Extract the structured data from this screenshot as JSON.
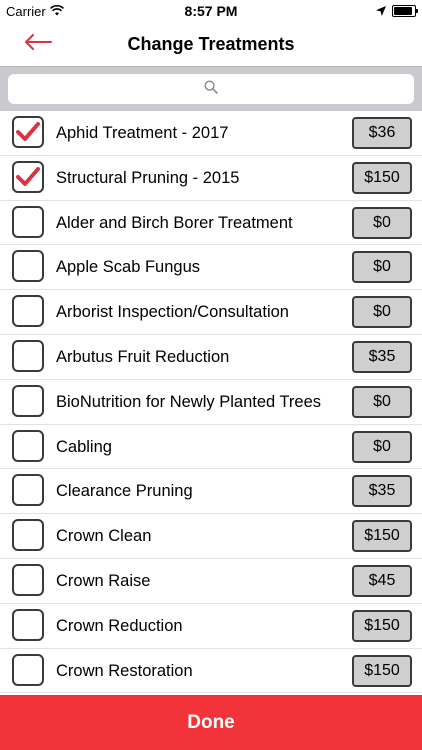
{
  "status_bar": {
    "carrier": "Carrier",
    "time": "8:57 PM"
  },
  "nav": {
    "title": "Change Treatments"
  },
  "search": {
    "placeholder": ""
  },
  "treatments": [
    {
      "label": "Aphid Treatment - 2017",
      "price": "$36",
      "checked": true
    },
    {
      "label": "Structural Pruning - 2015",
      "price": "$150",
      "checked": true
    },
    {
      "label": "Alder and Birch Borer Treatment",
      "price": "$0",
      "checked": false
    },
    {
      "label": "Apple Scab Fungus",
      "price": "$0",
      "checked": false
    },
    {
      "label": "Arborist Inspection/Consultation",
      "price": "$0",
      "checked": false
    },
    {
      "label": "Arbutus Fruit Reduction",
      "price": "$35",
      "checked": false
    },
    {
      "label": "BioNutrition for Newly Planted Trees",
      "price": "$0",
      "checked": false
    },
    {
      "label": "Cabling",
      "price": "$0",
      "checked": false
    },
    {
      "label": "Clearance Pruning",
      "price": "$35",
      "checked": false
    },
    {
      "label": "Crown Clean",
      "price": "$150",
      "checked": false
    },
    {
      "label": "Crown Raise",
      "price": "$45",
      "checked": false
    },
    {
      "label": "Crown Reduction",
      "price": "$150",
      "checked": false
    },
    {
      "label": "Crown Restoration",
      "price": "$150",
      "checked": false
    }
  ],
  "done_label": "Done",
  "colors": {
    "accent": "#f2343a",
    "check": "#d9343f",
    "back_arrow": "#d9343f"
  },
  "icons": {
    "back": "back-arrow-icon",
    "search": "search-icon",
    "check": "checkmark-icon"
  }
}
